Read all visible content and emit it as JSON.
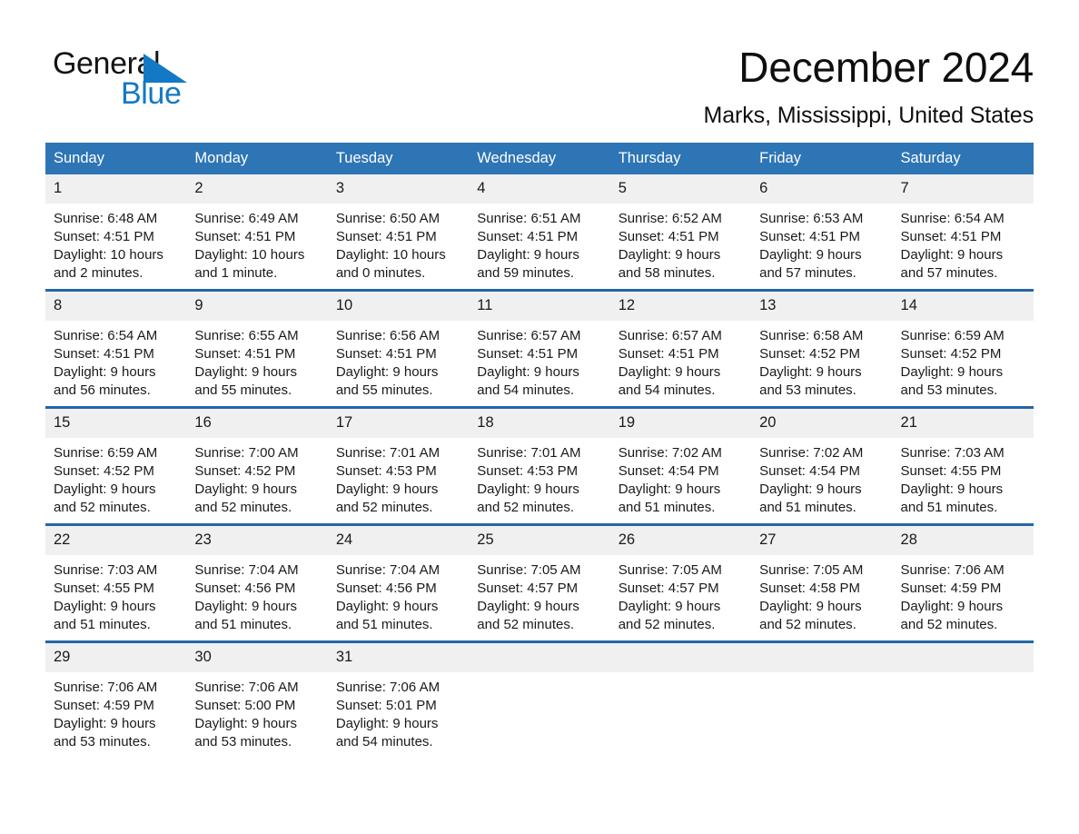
{
  "brand": {
    "name_top": "General",
    "name_bottom": "Blue",
    "triangle_icon": "blue-triangle-icon",
    "color_black": "#141414",
    "color_blue": "#1479c4"
  },
  "header": {
    "title": "December 2024",
    "location": "Marks, Mississippi, United States"
  },
  "theme": {
    "header_blue": "#2e75b6",
    "row_divider_blue": "#2565a8",
    "daynum_bg": "#f0f0f0",
    "text": "#1a1a1a"
  },
  "calendar": {
    "weekday_headers": [
      "Sunday",
      "Monday",
      "Tuesday",
      "Wednesday",
      "Thursday",
      "Friday",
      "Saturday"
    ],
    "weeks": [
      [
        {
          "day": "1",
          "sunrise": "Sunrise: 6:48 AM",
          "sunset": "Sunset: 4:51 PM",
          "daylight_1": "Daylight: 10 hours",
          "daylight_2": "and 2 minutes."
        },
        {
          "day": "2",
          "sunrise": "Sunrise: 6:49 AM",
          "sunset": "Sunset: 4:51 PM",
          "daylight_1": "Daylight: 10 hours",
          "daylight_2": "and 1 minute."
        },
        {
          "day": "3",
          "sunrise": "Sunrise: 6:50 AM",
          "sunset": "Sunset: 4:51 PM",
          "daylight_1": "Daylight: 10 hours",
          "daylight_2": "and 0 minutes."
        },
        {
          "day": "4",
          "sunrise": "Sunrise: 6:51 AM",
          "sunset": "Sunset: 4:51 PM",
          "daylight_1": "Daylight: 9 hours",
          "daylight_2": "and 59 minutes."
        },
        {
          "day": "5",
          "sunrise": "Sunrise: 6:52 AM",
          "sunset": "Sunset: 4:51 PM",
          "daylight_1": "Daylight: 9 hours",
          "daylight_2": "and 58 minutes."
        },
        {
          "day": "6",
          "sunrise": "Sunrise: 6:53 AM",
          "sunset": "Sunset: 4:51 PM",
          "daylight_1": "Daylight: 9 hours",
          "daylight_2": "and 57 minutes."
        },
        {
          "day": "7",
          "sunrise": "Sunrise: 6:54 AM",
          "sunset": "Sunset: 4:51 PM",
          "daylight_1": "Daylight: 9 hours",
          "daylight_2": "and 57 minutes."
        }
      ],
      [
        {
          "day": "8",
          "sunrise": "Sunrise: 6:54 AM",
          "sunset": "Sunset: 4:51 PM",
          "daylight_1": "Daylight: 9 hours",
          "daylight_2": "and 56 minutes."
        },
        {
          "day": "9",
          "sunrise": "Sunrise: 6:55 AM",
          "sunset": "Sunset: 4:51 PM",
          "daylight_1": "Daylight: 9 hours",
          "daylight_2": "and 55 minutes."
        },
        {
          "day": "10",
          "sunrise": "Sunrise: 6:56 AM",
          "sunset": "Sunset: 4:51 PM",
          "daylight_1": "Daylight: 9 hours",
          "daylight_2": "and 55 minutes."
        },
        {
          "day": "11",
          "sunrise": "Sunrise: 6:57 AM",
          "sunset": "Sunset: 4:51 PM",
          "daylight_1": "Daylight: 9 hours",
          "daylight_2": "and 54 minutes."
        },
        {
          "day": "12",
          "sunrise": "Sunrise: 6:57 AM",
          "sunset": "Sunset: 4:51 PM",
          "daylight_1": "Daylight: 9 hours",
          "daylight_2": "and 54 minutes."
        },
        {
          "day": "13",
          "sunrise": "Sunrise: 6:58 AM",
          "sunset": "Sunset: 4:52 PM",
          "daylight_1": "Daylight: 9 hours",
          "daylight_2": "and 53 minutes."
        },
        {
          "day": "14",
          "sunrise": "Sunrise: 6:59 AM",
          "sunset": "Sunset: 4:52 PM",
          "daylight_1": "Daylight: 9 hours",
          "daylight_2": "and 53 minutes."
        }
      ],
      [
        {
          "day": "15",
          "sunrise": "Sunrise: 6:59 AM",
          "sunset": "Sunset: 4:52 PM",
          "daylight_1": "Daylight: 9 hours",
          "daylight_2": "and 52 minutes."
        },
        {
          "day": "16",
          "sunrise": "Sunrise: 7:00 AM",
          "sunset": "Sunset: 4:52 PM",
          "daylight_1": "Daylight: 9 hours",
          "daylight_2": "and 52 minutes."
        },
        {
          "day": "17",
          "sunrise": "Sunrise: 7:01 AM",
          "sunset": "Sunset: 4:53 PM",
          "daylight_1": "Daylight: 9 hours",
          "daylight_2": "and 52 minutes."
        },
        {
          "day": "18",
          "sunrise": "Sunrise: 7:01 AM",
          "sunset": "Sunset: 4:53 PM",
          "daylight_1": "Daylight: 9 hours",
          "daylight_2": "and 52 minutes."
        },
        {
          "day": "19",
          "sunrise": "Sunrise: 7:02 AM",
          "sunset": "Sunset: 4:54 PM",
          "daylight_1": "Daylight: 9 hours",
          "daylight_2": "and 51 minutes."
        },
        {
          "day": "20",
          "sunrise": "Sunrise: 7:02 AM",
          "sunset": "Sunset: 4:54 PM",
          "daylight_1": "Daylight: 9 hours",
          "daylight_2": "and 51 minutes."
        },
        {
          "day": "21",
          "sunrise": "Sunrise: 7:03 AM",
          "sunset": "Sunset: 4:55 PM",
          "daylight_1": "Daylight: 9 hours",
          "daylight_2": "and 51 minutes."
        }
      ],
      [
        {
          "day": "22",
          "sunrise": "Sunrise: 7:03 AM",
          "sunset": "Sunset: 4:55 PM",
          "daylight_1": "Daylight: 9 hours",
          "daylight_2": "and 51 minutes."
        },
        {
          "day": "23",
          "sunrise": "Sunrise: 7:04 AM",
          "sunset": "Sunset: 4:56 PM",
          "daylight_1": "Daylight: 9 hours",
          "daylight_2": "and 51 minutes."
        },
        {
          "day": "24",
          "sunrise": "Sunrise: 7:04 AM",
          "sunset": "Sunset: 4:56 PM",
          "daylight_1": "Daylight: 9 hours",
          "daylight_2": "and 51 minutes."
        },
        {
          "day": "25",
          "sunrise": "Sunrise: 7:05 AM",
          "sunset": "Sunset: 4:57 PM",
          "daylight_1": "Daylight: 9 hours",
          "daylight_2": "and 52 minutes."
        },
        {
          "day": "26",
          "sunrise": "Sunrise: 7:05 AM",
          "sunset": "Sunset: 4:57 PM",
          "daylight_1": "Daylight: 9 hours",
          "daylight_2": "and 52 minutes."
        },
        {
          "day": "27",
          "sunrise": "Sunrise: 7:05 AM",
          "sunset": "Sunset: 4:58 PM",
          "daylight_1": "Daylight: 9 hours",
          "daylight_2": "and 52 minutes."
        },
        {
          "day": "28",
          "sunrise": "Sunrise: 7:06 AM",
          "sunset": "Sunset: 4:59 PM",
          "daylight_1": "Daylight: 9 hours",
          "daylight_2": "and 52 minutes."
        }
      ],
      [
        {
          "day": "29",
          "sunrise": "Sunrise: 7:06 AM",
          "sunset": "Sunset: 4:59 PM",
          "daylight_1": "Daylight: 9 hours",
          "daylight_2": "and 53 minutes."
        },
        {
          "day": "30",
          "sunrise": "Sunrise: 7:06 AM",
          "sunset": "Sunset: 5:00 PM",
          "daylight_1": "Daylight: 9 hours",
          "daylight_2": "and 53 minutes."
        },
        {
          "day": "31",
          "sunrise": "Sunrise: 7:06 AM",
          "sunset": "Sunset: 5:01 PM",
          "daylight_1": "Daylight: 9 hours",
          "daylight_2": "and 54 minutes."
        },
        {
          "day": "",
          "sunrise": "",
          "sunset": "",
          "daylight_1": "",
          "daylight_2": ""
        },
        {
          "day": "",
          "sunrise": "",
          "sunset": "",
          "daylight_1": "",
          "daylight_2": ""
        },
        {
          "day": "",
          "sunrise": "",
          "sunset": "",
          "daylight_1": "",
          "daylight_2": ""
        },
        {
          "day": "",
          "sunrise": "",
          "sunset": "",
          "daylight_1": "",
          "daylight_2": ""
        }
      ]
    ]
  }
}
